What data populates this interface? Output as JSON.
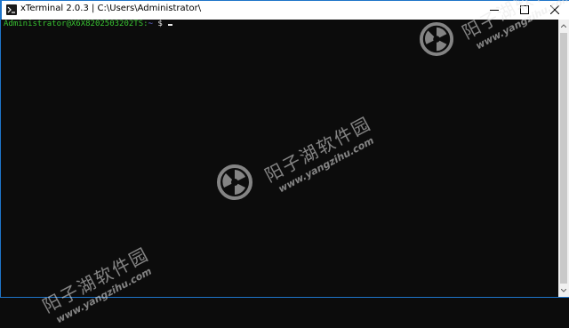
{
  "window": {
    "title": "xTerminal 2.0.3 | C:\\Users\\Administrator\\"
  },
  "terminal": {
    "user_host": "Administrator@X6X8202503202TS:",
    "path": "~",
    "symbol": "$"
  },
  "watermark": {
    "text_cn": "阳子湖软件园",
    "text_url": "www.yangzihu.com"
  },
  "icons": {
    "app": "terminal-prompt-icon",
    "minimize": "minimize-icon",
    "maximize": "maximize-icon",
    "close": "close-icon"
  },
  "colors": {
    "background": "#0c0c0c",
    "prompt_user": "#39c432",
    "prompt_path": "#6e74e8",
    "window_border": "#1e74c9"
  }
}
